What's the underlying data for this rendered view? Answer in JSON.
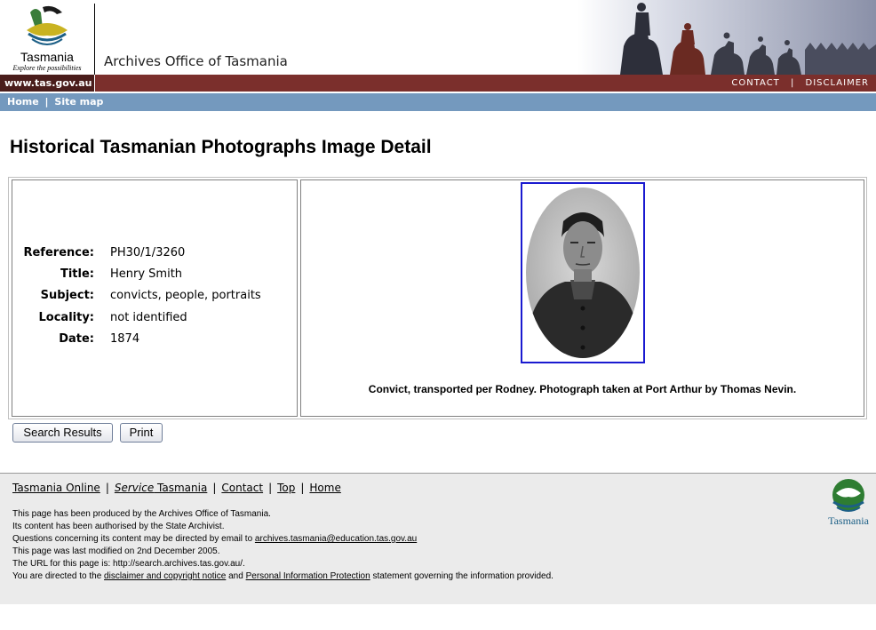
{
  "header": {
    "logo_word": "Tasmania",
    "logo_tagline": "Explore the possibilities",
    "site_name": "Archives Office of Tasmania",
    "url_label": "www.tas.gov.au",
    "contact_label": "CONTACT",
    "disclaimer_label": "DISCLAIMER",
    "link_separator": "|"
  },
  "nav": {
    "home_label": "Home",
    "sitemap_label": "Site map",
    "separator": "|"
  },
  "page_title": "Historical Tasmanian Photographs Image Detail",
  "record": {
    "fields": [
      {
        "label": "Reference:",
        "value": "PH30/1/3260"
      },
      {
        "label": "Title:",
        "value": "Henry Smith"
      },
      {
        "label": "Subject:",
        "value": "convicts, people, portraits"
      },
      {
        "label": "Locality:",
        "value": "not identified"
      },
      {
        "label": "Date:",
        "value": "1874"
      }
    ],
    "caption": "Convict, transported per Rodney. Photograph taken at Port Arthur by Thomas Nevin."
  },
  "buttons": {
    "search_results": "Search Results",
    "print": "Print"
  },
  "footer": {
    "links": {
      "tasmania_online": "Tasmania Online",
      "service_italic": "Service",
      "service_rest": " Tasmania",
      "contact": "Contact",
      "top": "Top",
      "home": "Home",
      "separator": "|"
    },
    "lines": {
      "produced": "This page has been produced by the Archives Office of Tasmania.",
      "authorised": "Its content has been authorised by the State Archivist.",
      "questions_prefix": "Questions concerning its content may be directed by email to ",
      "email": "archives.tasmania@education.tas.gov.au",
      "modified": "This page was last modified on 2nd December 2005.",
      "url_line": "The URL for this page is: http://search.archives.tas.gov.au/.",
      "directed_prefix": "You are directed to the ",
      "disclaimer_link": "disclaimer and copyright notice",
      "and_text": " and ",
      "pip_link": "Personal Information Protection",
      "directed_suffix": " statement governing the information provided."
    },
    "logo_word": "Tasmania"
  },
  "colors": {
    "header_red": "#7b2f2c",
    "header_dark_red": "#4a1d1b",
    "nav_blue": "#7499be",
    "photo_border": "#1a1ad0",
    "footer_bg": "#ebebeb",
    "logo_teal": "#1c5f86",
    "logo_green": "#2e7d32"
  }
}
